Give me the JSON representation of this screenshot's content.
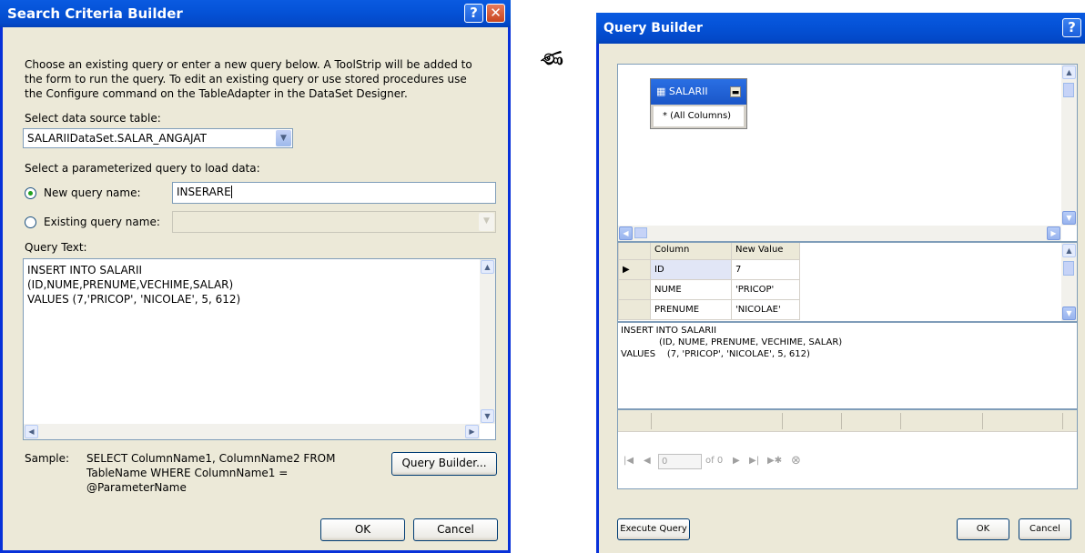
{
  "left_dialog": {
    "title": "Search Criteria Builder",
    "help_glyph": "?",
    "close_glyph": "✕",
    "description": [
      "Choose an existing query or enter a new query below. A ToolStrip will be added to",
      "the form to run the query. To edit an existing query or use stored procedures use",
      "the Configure command on the TableAdapter in the DataSet Designer."
    ],
    "source_table_label": "Select data source table:",
    "source_table_value": "SALARIIDataSet.SALAR_ANGAJAT",
    "param_query_label": "Select a parameterized query to load data:",
    "new_query_label": "New query name:",
    "new_query_value": "INSERARE",
    "existing_query_label": "Existing query name:",
    "query_text_label": "Query Text:",
    "query_text_lines": [
      "INSERT INTO SALARII",
      "(ID,NUME,PRENUME,VECHIME,SALAR)",
      "VALUES (7,'PRICOP', 'NICOLAE', 5, 612)"
    ],
    "sample_label": "Sample:",
    "sample_lines": [
      "SELECT ColumnName1, ColumnName2 FROM",
      "TableName WHERE ColumnName1 =",
      "@ParameterName"
    ],
    "query_builder_button": "Query Builder...",
    "ok_button": "OK",
    "cancel_button": "Cancel"
  },
  "separator_glyph": "ණ",
  "right_dialog": {
    "title": "Query Builder",
    "help_glyph": "?",
    "table_name": "SALARII",
    "all_columns": "* (All Columns)",
    "grid": {
      "headers": [
        "Column",
        "New Value"
      ],
      "rows": [
        {
          "column": "ID",
          "value": "7"
        },
        {
          "column": "NUME",
          "value": "'PRICOP'"
        },
        {
          "column": "PRENUME",
          "value": "'NICOLAE'"
        }
      ]
    },
    "sql_lines": [
      "INSERT INTO SALARII",
      "(ID, NUME, PRENUME, VECHIME, SALAR)",
      "VALUES    (7, 'PRICOP', 'NICOLAE', 5, 612)"
    ],
    "nav": {
      "first": "|◀",
      "prev": "◀",
      "position": "0",
      "of_label": "of 0",
      "next": "▶",
      "last": "▶|",
      "new": "▶✱",
      "delete": "⊗"
    },
    "execute_button": "Execute Query",
    "ok_button": "OK",
    "cancel_button": "Cancel"
  }
}
